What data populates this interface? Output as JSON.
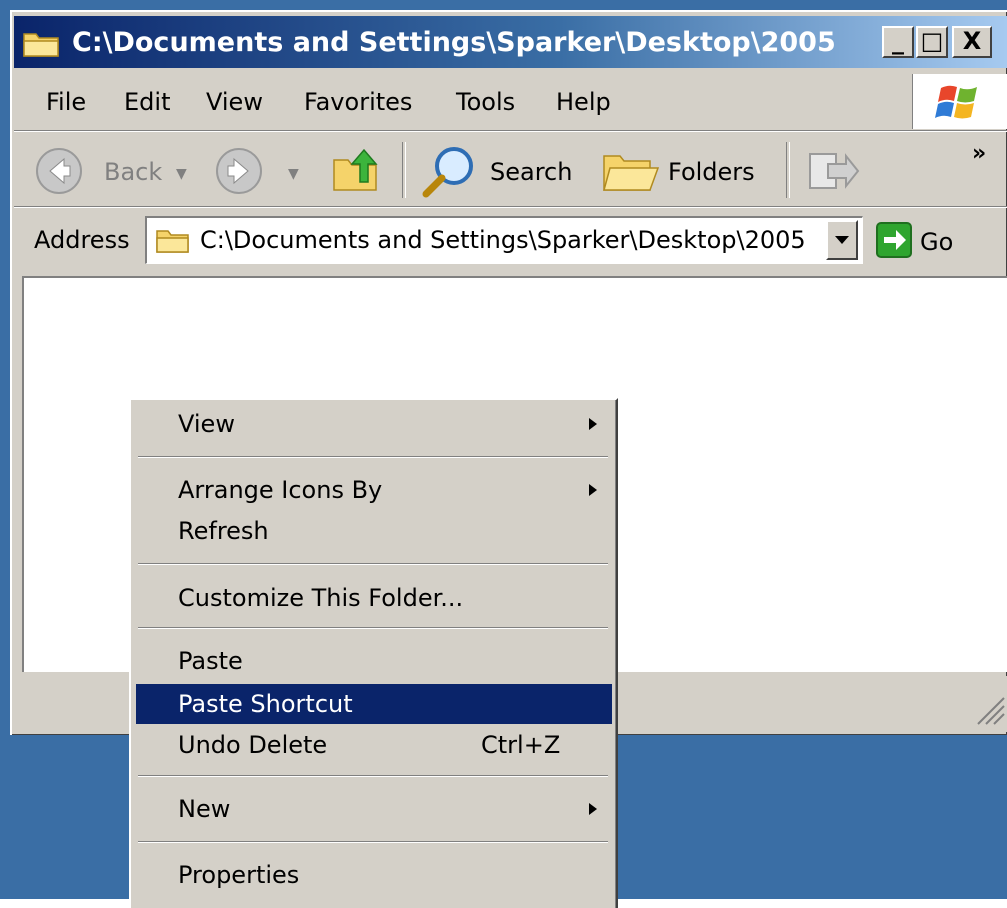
{
  "window": {
    "title": "C:\\Documents and Settings\\Sparker\\Desktop\\2005",
    "minimize_label": "_",
    "restore_label": "□",
    "close_label": "X"
  },
  "menubar": {
    "items": [
      "File",
      "Edit",
      "View",
      "Favorites",
      "Tools",
      "Help"
    ]
  },
  "toolbar": {
    "back_label": "Back",
    "search_label": "Search",
    "folders_label": "Folders",
    "chevron_label": "»"
  },
  "address": {
    "label": "Address",
    "value": "C:\\Documents and Settings\\Sparker\\Desktop\\2005",
    "go_label": "Go"
  },
  "context_menu": {
    "items": [
      {
        "label": "View",
        "submenu": true
      },
      {
        "label": "Arrange Icons By",
        "submenu": true
      },
      {
        "label": "Refresh"
      },
      {
        "label": "Customize This Folder..."
      },
      {
        "label": "Paste"
      },
      {
        "label": "Paste Shortcut",
        "highlighted": true
      },
      {
        "label": "Undo Delete",
        "shortcut": "Ctrl+Z"
      },
      {
        "label": "New",
        "submenu": true
      },
      {
        "label": "Properties"
      }
    ]
  },
  "colors": {
    "title_active": "#0a246a",
    "face": "#d4d0c8",
    "desktop": "#3a6ea5",
    "highlight": "#0a246a"
  }
}
